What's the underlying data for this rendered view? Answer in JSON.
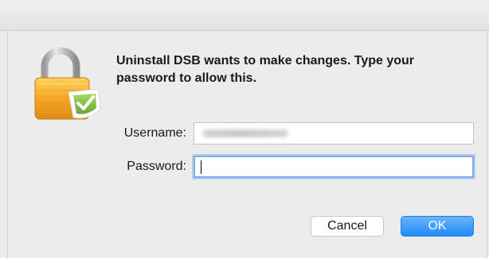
{
  "dialog": {
    "message": "Uninstall DSB wants to make changes. Type your password to allow this.",
    "icon": "lock-icon"
  },
  "form": {
    "username_label": "Username:",
    "username_value": "",
    "password_label": "Password:",
    "password_value": ""
  },
  "buttons": {
    "cancel_label": "Cancel",
    "ok_label": "OK"
  },
  "colors": {
    "accent": "#1f8cf7",
    "focus_ring": "#7aadea",
    "lock_gold": "#f0a52c",
    "check_green": "#7fb843"
  }
}
